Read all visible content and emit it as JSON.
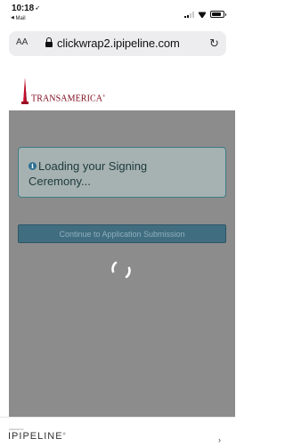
{
  "status_bar": {
    "time": "10:18",
    "location_arrow": "➶",
    "back_app": "Mail",
    "back_glyph": "◀"
  },
  "browser": {
    "text_size_label": "AA",
    "url": "clickwrap2.ipipeline.com",
    "reload_glyph": "↻"
  },
  "header": {
    "brand_name": "TRANSAMERICA",
    "brand_mark": "®",
    "brand_color": "#7e0b1c"
  },
  "alert": {
    "icon": "info-icon",
    "icon_glyph": "i",
    "message": "Loading your Signing Ceremony..."
  },
  "actions": {
    "continue_label": "Continue to Application Submission"
  },
  "footer": {
    "tagline": "powered by",
    "logo_text": "IPIPELINE",
    "logo_mark": "®",
    "nav_glyph": "›"
  },
  "colors": {
    "overlay": "#8c8c8c",
    "alert_bg": "#a6b2b1",
    "button_bg": "#416d80"
  }
}
